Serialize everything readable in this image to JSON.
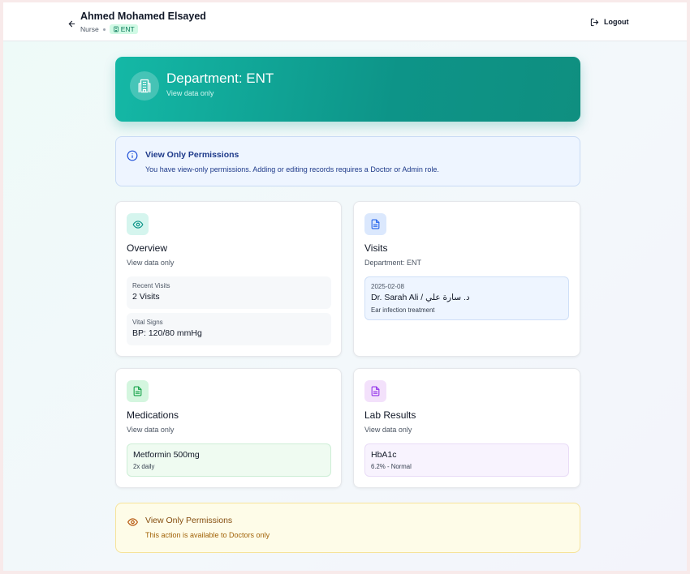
{
  "header": {
    "user_name": "Ahmed Mohamed Elsayed",
    "role": "Nurse",
    "department_badge": "ENT",
    "logout_label": "Logout"
  },
  "banner": {
    "title": "Department: ENT",
    "subtitle": "View data only"
  },
  "info_notice": {
    "title": "View Only Permissions",
    "text": "You have view-only permissions. Adding or editing records requires a Doctor or Admin role."
  },
  "cards": {
    "overview": {
      "icon": "eye-icon",
      "title": "Overview",
      "subtitle": "View data only",
      "items": [
        {
          "label": "Recent Visits",
          "value": "2 Visits"
        },
        {
          "label": "Vital Signs",
          "value": "BP: 120/80 mmHg"
        }
      ]
    },
    "visits": {
      "icon": "document-icon",
      "title": "Visits",
      "subtitle": "Department: ENT",
      "items": [
        {
          "date": "2025-02-08",
          "doctor": "Dr. Sarah Ali / د. سارة علي",
          "note": "Ear infection treatment"
        }
      ]
    },
    "medications": {
      "icon": "document-icon",
      "title": "Medications",
      "subtitle": "View data only",
      "items": [
        {
          "name": "Metformin 500mg",
          "dosage": "2x daily"
        }
      ]
    },
    "lab_results": {
      "icon": "document-icon",
      "title": "Lab Results",
      "subtitle": "View data only",
      "items": [
        {
          "name": "HbA1c",
          "result": "6.2% - Normal"
        }
      ]
    }
  },
  "warning_notice": {
    "title": "View Only Permissions",
    "text": "This action is available to Doctors only"
  },
  "colors": {
    "accent": "#0d9488",
    "info_bg": "#eef5ff",
    "warning_bg": "#fefce8"
  }
}
